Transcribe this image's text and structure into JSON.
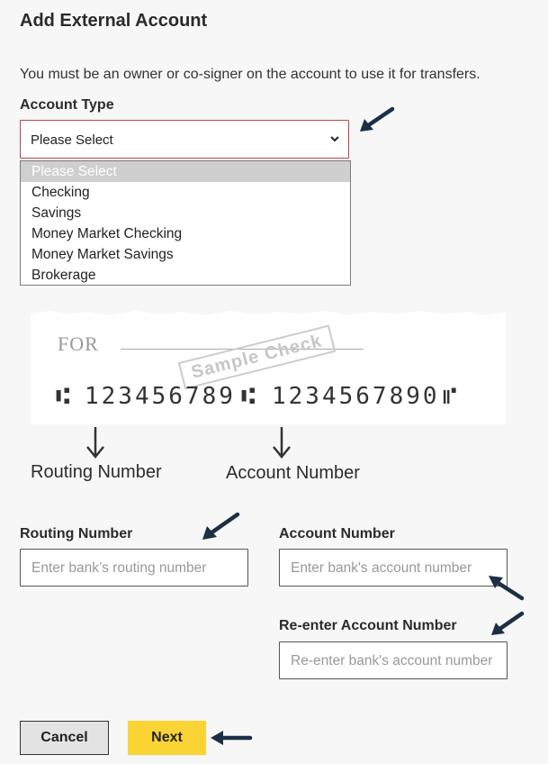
{
  "title": "Add External Account",
  "notice": "You must be an owner or co-signer on the account to use it for transfers.",
  "account_type": {
    "label": "Account Type",
    "selected": "Please Select",
    "options": [
      "Please Select",
      "Checking",
      "Savings",
      "Money Market Checking",
      "Money Market Savings",
      "Brokerage"
    ]
  },
  "sample_check": {
    "for_text": "FOR",
    "stamp": "Sample Check",
    "routing_digits": "123456789",
    "account_digits": "1234567890",
    "routing_caption": "Routing Number",
    "account_caption": "Account Number"
  },
  "routing": {
    "label": "Routing Number",
    "placeholder": "Enter bank’s routing number"
  },
  "account": {
    "label": "Account Number",
    "placeholder": "Enter bank's account number"
  },
  "reenter": {
    "label": "Re-enter Account Number",
    "placeholder": "Re-enter bank's account number"
  },
  "buttons": {
    "cancel": "Cancel",
    "next": "Next"
  },
  "colors": {
    "next_bg": "#f9d434",
    "arrow": "#1c2f45",
    "select_border": "#b8474f"
  },
  "icons": [
    "chevron-down-icon",
    "arrow-pointer-icon"
  ]
}
